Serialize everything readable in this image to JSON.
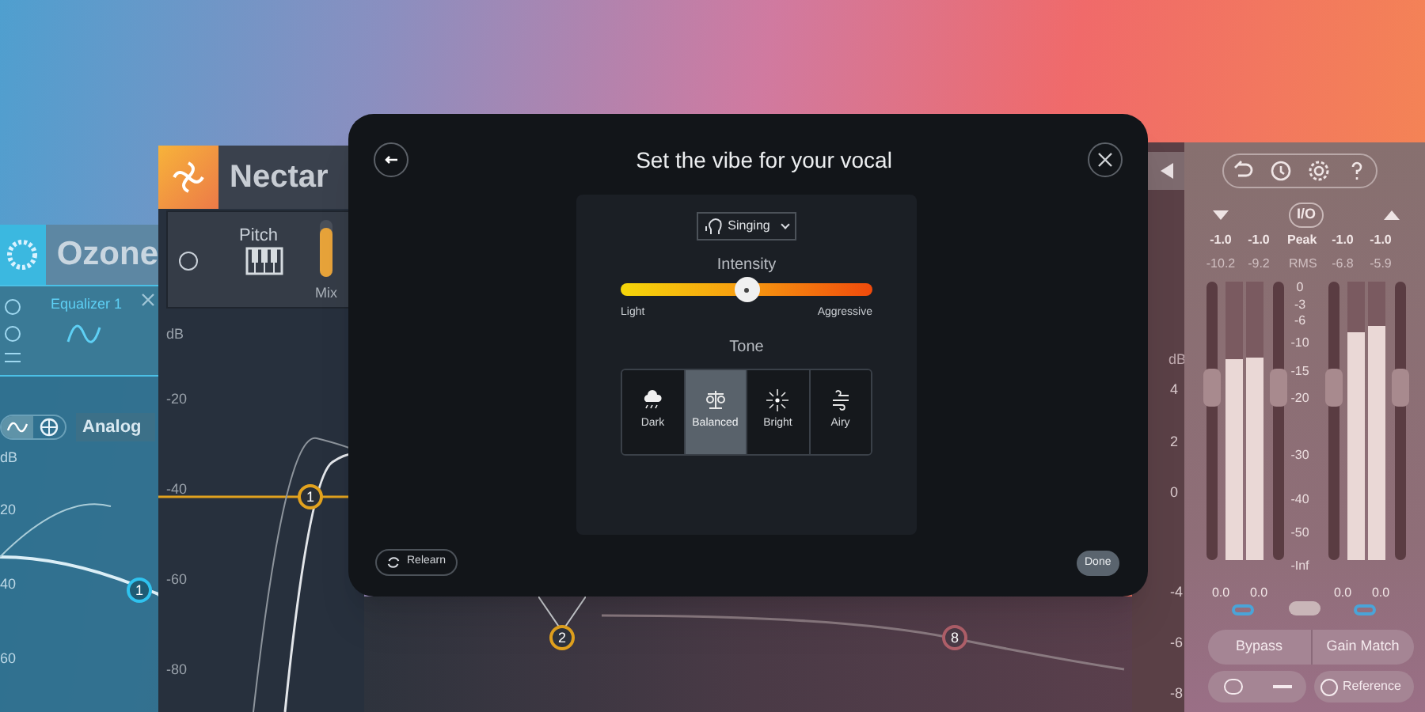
{
  "ozone": {
    "title": "Ozone",
    "module": "Equalizer 1",
    "mode": "Analog",
    "db_label": "dB",
    "db_ticks": [
      "20",
      "40",
      "60"
    ],
    "node": "1"
  },
  "nectar": {
    "title": "Nectar",
    "module": "Pitch",
    "mix": {
      "label": "Mix",
      "level": 0.85
    },
    "db_label": "dB",
    "db_ticks": [
      "-20",
      "-40",
      "-60",
      "-80"
    ],
    "nodes": [
      {
        "label": "1",
        "color": "#e2a21e"
      },
      {
        "label": "2",
        "color": "#e2a21e"
      },
      {
        "label": "8",
        "color": "#b0606a"
      }
    ]
  },
  "side_scale": {
    "label": "dB",
    "ticks": [
      "4",
      "2",
      "0",
      "-4",
      "-6",
      "-8"
    ]
  },
  "dialog": {
    "title": "Set the vibe for your vocal",
    "style": "Singing",
    "intensity": {
      "label": "Intensity",
      "level": 0.5,
      "min_label": "Light",
      "max_label": "Aggressive"
    },
    "tone": {
      "label": "Tone",
      "options": [
        {
          "kind": "dark",
          "label": "Dark",
          "selected": false
        },
        {
          "kind": "balanced",
          "label": "Balanced",
          "selected": true
        },
        {
          "kind": "bright",
          "label": "Bright",
          "selected": false
        },
        {
          "kind": "airy",
          "label": "Airy",
          "selected": false
        }
      ]
    },
    "relearn": "Relearn",
    "done": "Done"
  },
  "meters": {
    "io": "I/O",
    "peak_label": "Peak",
    "rms_label": "RMS",
    "scale": [
      "0",
      "-3",
      "-6",
      "-10",
      "-15",
      "-20",
      "-30",
      "-40",
      "-50",
      "-Inf"
    ],
    "groups": [
      {
        "fader": {
          "level": 0.62
        },
        "channels": [
          {
            "peak": "-1.0",
            "rms": "-10.2",
            "level": 0.72,
            "readout": "0.0"
          },
          {
            "peak": "-1.0",
            "rms": "-9.2",
            "level": 0.73,
            "readout": "0.0"
          }
        ]
      },
      {
        "fader": {
          "level": 0.62
        },
        "channels": [
          {
            "peak": "-1.0",
            "rms": "-6.8",
            "level": 0.82,
            "readout": "0.0"
          },
          {
            "peak": "-1.0",
            "rms": "-5.9",
            "level": 0.84,
            "readout": "0.0"
          }
        ]
      }
    ],
    "buttons": [
      "Bypass",
      "Gain Match"
    ],
    "reference": "Reference"
  }
}
